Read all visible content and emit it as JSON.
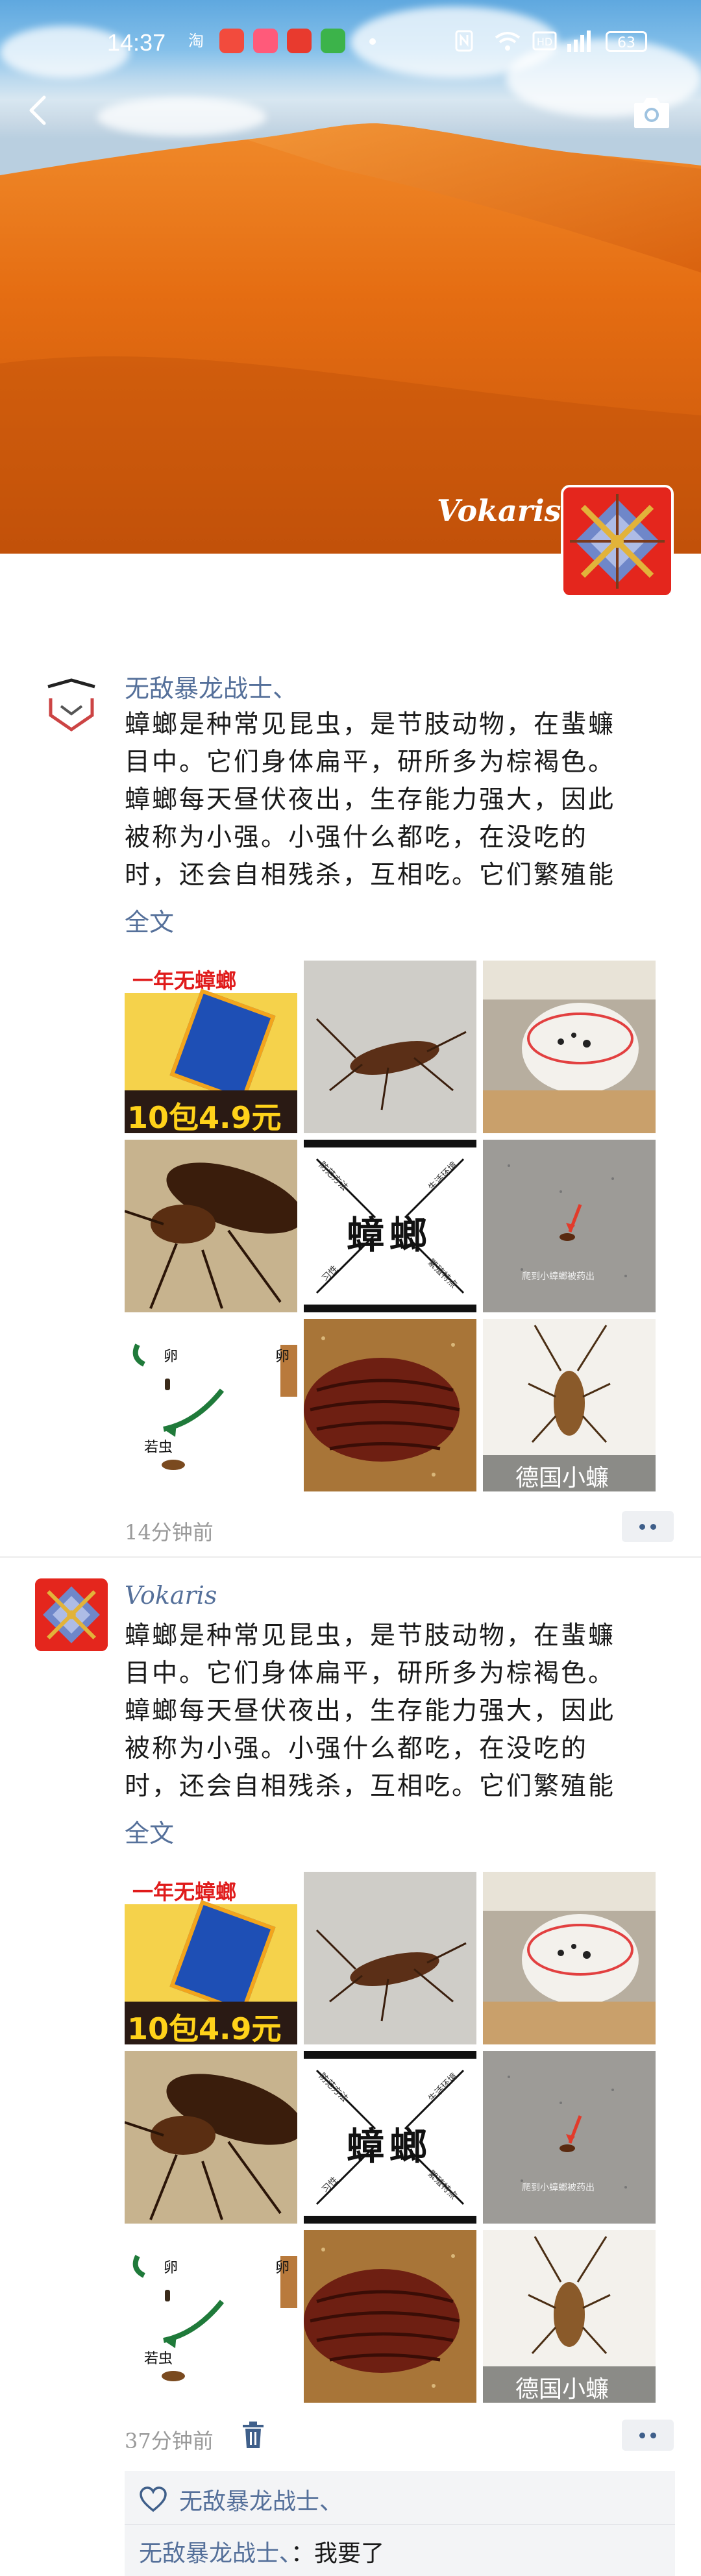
{
  "status_bar": {
    "time": "14:37",
    "battery": "63",
    "icons": [
      "taobao-icon",
      "app-badge-icon",
      "app-pink-icon",
      "app-red-icon",
      "app-green-icon",
      "nfc-icon",
      "hd-icon",
      "wifi-icon",
      "signal-icon",
      "battery-icon"
    ]
  },
  "cover": {
    "user_name": "Vokaris",
    "colors": {
      "sand": "#e86a14",
      "sky": "#7fb8e3"
    }
  },
  "posts": [
    {
      "user": "无敌暴龙战士、",
      "text_lines": [
        "蟑螂是种常见昆虫，是节肢动物，在蜚蠊",
        "目中。它们身体扁平，研所多为棕褐色。",
        "蟑螂每天昼伏夜出，生存能力强大，因此",
        "被称为小强。小强什么都吃，在没吃的",
        "时，还会自相残杀，互相吃。它们繁殖能"
      ],
      "full_text_link": "全文",
      "time": "14分钟前"
    },
    {
      "user": "Vokaris",
      "text_lines": [
        "蟑螂是种常见昆虫，是节肢动物，在蜚蠊",
        "目中。它们身体扁平，研所多为棕褐色。",
        "蟑螂每天昼伏夜出，生存能力强大，因此",
        "被称为小强。小强什么都吃，在没吃的",
        "时，还会自相残杀，互相吃。它们繁殖能"
      ],
      "full_text_link": "全文",
      "time": "37分钟前",
      "likes": [
        "无敌暴龙战士、"
      ],
      "comments": [
        {
          "user": "无敌暴龙战士、",
          "sep": "：",
          "text": "我要了"
        }
      ]
    }
  ],
  "grid_texts": {
    "ad_top": "一年无蟑螂",
    "ad_price": "10包4.9元",
    "diagram_title": "蟑螂",
    "diagram_labels": [
      "防范方法",
      "生活环境",
      "习性",
      "繁殖特点"
    ],
    "lifecycle_egg": "卵",
    "lifecycle_egg2": "卵",
    "lifecycle_nymph": "若虫",
    "german_label": "德国小蠊",
    "floor_caption": "爬到小蟑螂被药出"
  }
}
